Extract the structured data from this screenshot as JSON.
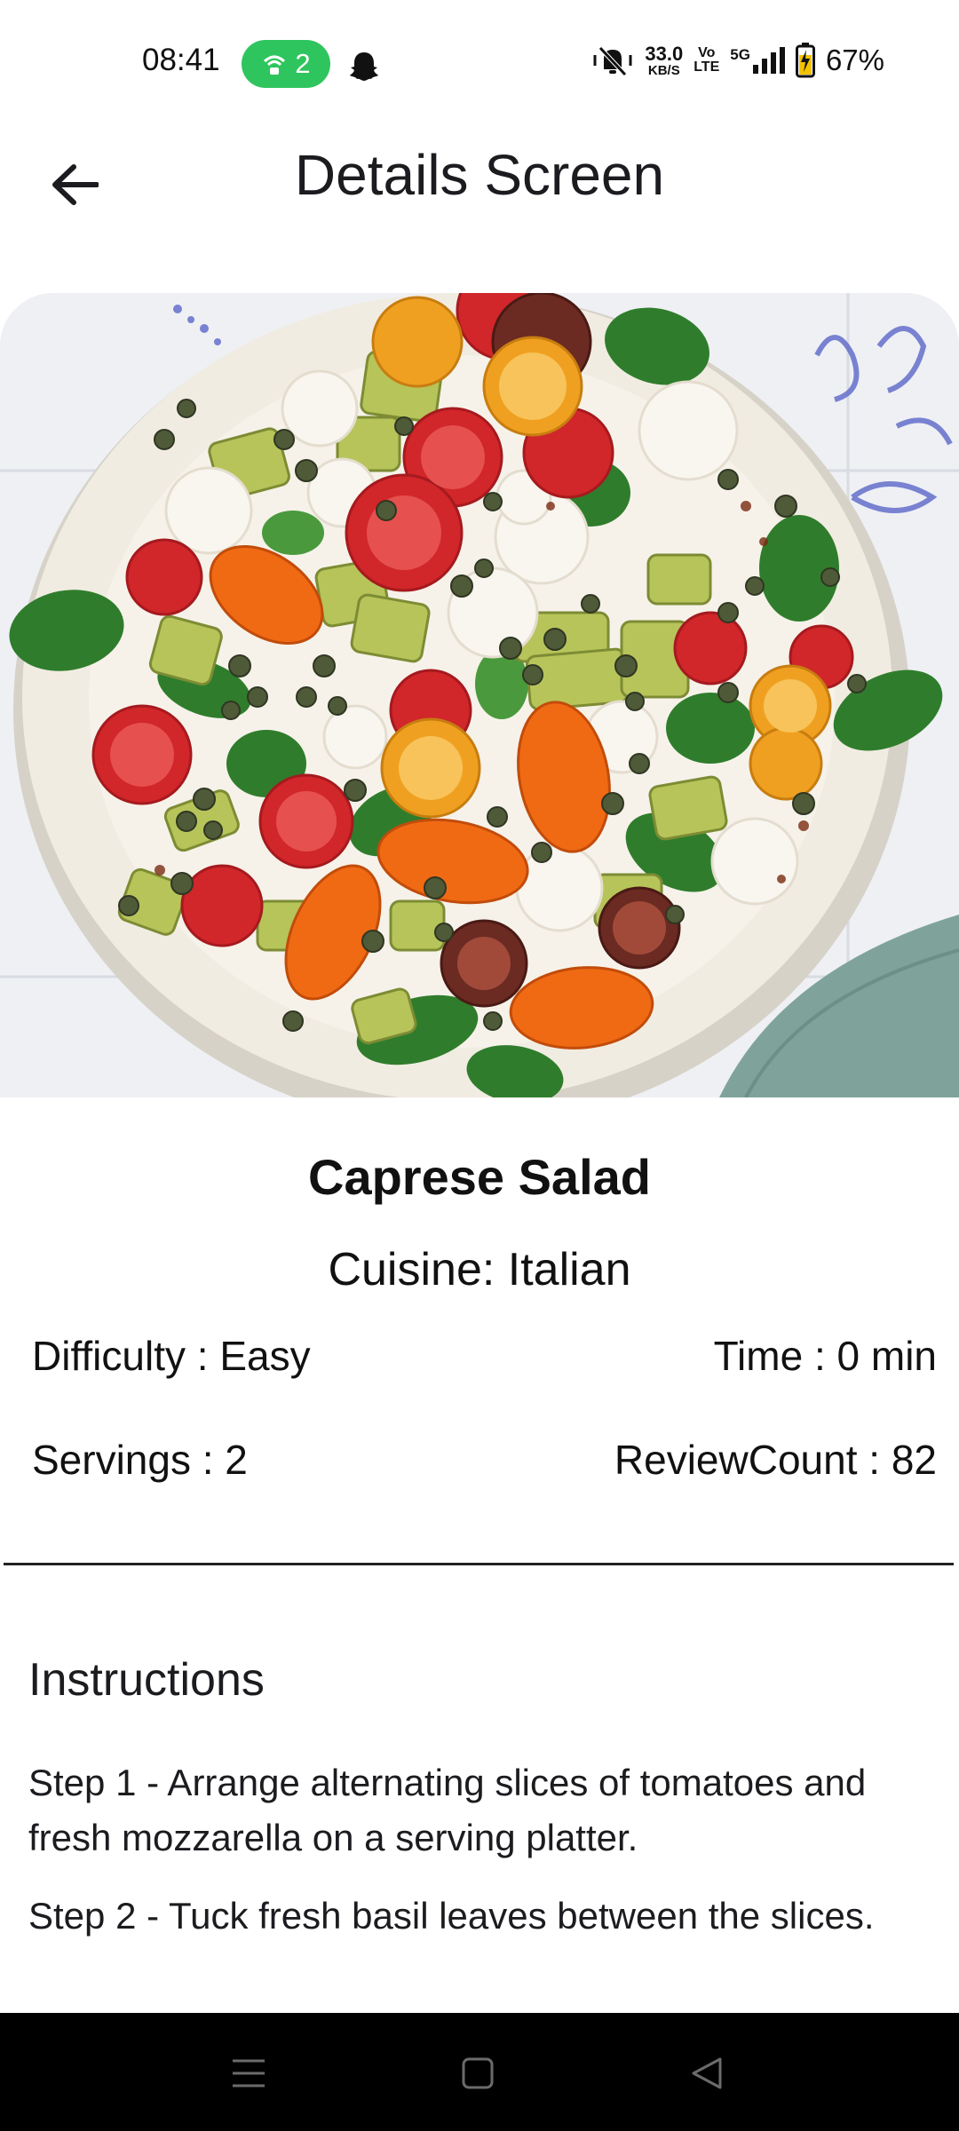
{
  "status_bar": {
    "time": "08:41",
    "hotspot_count": "2",
    "data_rate": "33.0",
    "data_rate_unit": "KB/S",
    "volte_top": "Vo",
    "volte_bottom": "LTE",
    "network": "5G",
    "battery": "67%",
    "icons": [
      "wifi-hotspot-icon",
      "snapchat-icon",
      "mute-vibrate-icon",
      "signal-icon",
      "battery-charging-icon"
    ]
  },
  "app_bar": {
    "title": "Details Screen",
    "back_icon": "arrow-left-icon"
  },
  "recipe": {
    "name": "Caprese Salad",
    "cuisine": "Cuisine: Italian",
    "difficulty": "Difficulty : Easy",
    "time": "Time :  0 min",
    "servings": "Servings : 2",
    "review_count": "ReviewCount :  82"
  },
  "instructions": {
    "title": "Instructions",
    "steps": [
      "Step 1 - Arrange alternating slices of tomatoes and fresh mozzarella on a serving platter.",
      "Step 2 - Tuck fresh basil leaves between the slices."
    ]
  },
  "nav_bar": {
    "icons": [
      "menu-icon",
      "home-square-icon",
      "back-triangle-icon"
    ]
  },
  "colors": {
    "hotspot_green": "#2fc55e",
    "nav_bar": "#000000",
    "plate": "#f1ece2",
    "tile_blue": "#5b67c9"
  }
}
